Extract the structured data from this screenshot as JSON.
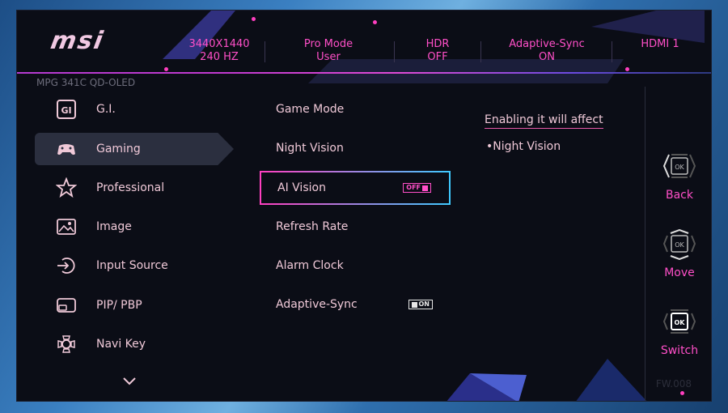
{
  "header": {
    "logo": "msi",
    "model": "MPG 341C QD-OLED",
    "stats": [
      {
        "line1": "3440X1440",
        "line2": "240 HZ"
      },
      {
        "line1": "Pro Mode",
        "line2": "User"
      },
      {
        "line1": "HDR",
        "line2": "OFF"
      },
      {
        "line1": "Adaptive-Sync",
        "line2": "ON"
      },
      {
        "line1": "HDMI 1",
        "line2": ""
      }
    ]
  },
  "menu": {
    "items": [
      {
        "label": "G.I.",
        "icon": "gi-icon"
      },
      {
        "label": "Gaming",
        "icon": "gamepad-icon",
        "active": true
      },
      {
        "label": "Professional",
        "icon": "star-icon"
      },
      {
        "label": "Image",
        "icon": "image-icon"
      },
      {
        "label": "Input Source",
        "icon": "input-source-icon"
      },
      {
        "label": "PIP/ PBP",
        "icon": "pip-icon"
      },
      {
        "label": "Navi Key",
        "icon": "navi-key-icon"
      }
    ]
  },
  "submenu": {
    "items": [
      {
        "label": "Game Mode"
      },
      {
        "label": "Night Vision"
      },
      {
        "label": "AI Vision",
        "toggle": "OFF",
        "selected": true
      },
      {
        "label": "Refresh Rate"
      },
      {
        "label": "Alarm Clock"
      },
      {
        "label": "Adaptive-Sync",
        "toggle": "ON"
      }
    ]
  },
  "info": {
    "title": "Enabling it will affect",
    "items": [
      "•Night Vision"
    ]
  },
  "navkeys": [
    {
      "label": "Back",
      "icon": "ok-left-icon"
    },
    {
      "label": "Move",
      "icon": "ok-updown-icon"
    },
    {
      "label": "Switch",
      "icon": "ok-press-icon"
    }
  ],
  "firmware": "FW.008",
  "colors": {
    "accent": "#ff4fc8",
    "text": "#f0c9d8",
    "cyan": "#3fc9ff",
    "bg": "#0b0d16"
  }
}
